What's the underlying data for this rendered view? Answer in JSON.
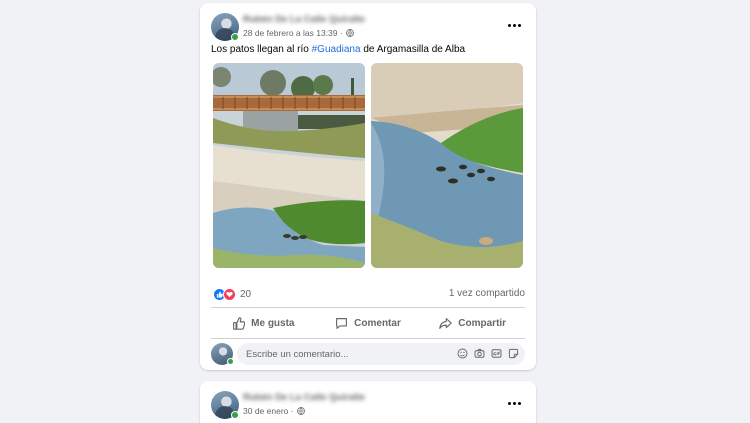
{
  "posts": [
    {
      "author": "Rubén De La Calle Quiralte",
      "date": "28 de febrero a las 13:39 ·",
      "text_before": "Los patos llegan al río ",
      "hashtag": "#Guadiana",
      "text_after": " de Argamasilla de Alba",
      "reactions_count": "20",
      "shares": "1 vez compartido",
      "actions": {
        "like": "Me gusta",
        "comment": "Comentar",
        "share": "Compartir"
      },
      "comment_placeholder": "Escribe un comentario..."
    },
    {
      "author": "Rubén De La Calle Quiralte",
      "date": "30 de enero ·"
    }
  ],
  "colors": {
    "hashtag": "#216fdb",
    "like_blue": "#1877f2",
    "love_red": "#f33e58",
    "online": "#31a24c"
  },
  "icons": [
    "more-icon",
    "globe-icon",
    "like-icon",
    "love-icon",
    "thumb-up-icon",
    "comment-icon",
    "share-icon",
    "emoji-icon",
    "camera-icon",
    "gif-icon",
    "sticker-icon"
  ]
}
